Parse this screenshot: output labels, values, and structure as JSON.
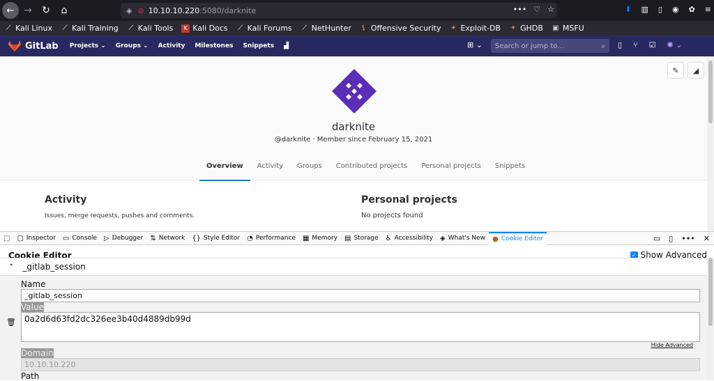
{
  "browser": {
    "url_host": "10.10.10.220",
    "url_rest": ":5080/darknite"
  },
  "bookmarks": [
    {
      "label": "Kali Linux",
      "icon": "kali-dragon-icon"
    },
    {
      "label": "Kali Training",
      "icon": "kali-dragon-icon"
    },
    {
      "label": "Kali Tools",
      "icon": "kali-dragon-icon"
    },
    {
      "label": "Kali Docs",
      "icon": "kali-docs-icon"
    },
    {
      "label": "Kali Forums",
      "icon": "kali-dragon-icon"
    },
    {
      "label": "NetHunter",
      "icon": "kali-dragon-icon"
    },
    {
      "label": "Offensive Security",
      "icon": "offsec-icon"
    },
    {
      "label": "Exploit-DB",
      "icon": "exploitdb-icon"
    },
    {
      "label": "GHDB",
      "icon": "ghdb-icon"
    },
    {
      "label": "MSFU",
      "icon": "msfu-icon"
    }
  ],
  "gitlab": {
    "brand": "GitLab",
    "menu": [
      "Projects ⌄",
      "Groups ⌄",
      "Activity",
      "Milestones",
      "Snippets"
    ],
    "search_placeholder": "Search or jump to…"
  },
  "profile": {
    "name": "darknite",
    "meta": "@darknite  ·  Member since February 15, 2021",
    "tabs": [
      "Overview",
      "Activity",
      "Groups",
      "Contributed projects",
      "Personal projects",
      "Snippets"
    ],
    "activity_heading": "Activity",
    "activity_sub": "Issues, merge requests, pushes and comments.",
    "projects_heading": "Personal projects",
    "projects_sub": "No projects found"
  },
  "devtools": {
    "tabs": [
      {
        "label": "Inspector",
        "icon": "inspector-icon"
      },
      {
        "label": "Console",
        "icon": "console-icon"
      },
      {
        "label": "Debugger",
        "icon": "debugger-icon"
      },
      {
        "label": "Network",
        "icon": "network-icon"
      },
      {
        "label": "Style Editor",
        "icon": "style-editor-icon"
      },
      {
        "label": "Performance",
        "icon": "performance-icon"
      },
      {
        "label": "Memory",
        "icon": "memory-icon"
      },
      {
        "label": "Storage",
        "icon": "storage-icon"
      },
      {
        "label": "Accessibility",
        "icon": "accessibility-icon"
      },
      {
        "label": "What's New",
        "icon": "whats-new-icon"
      },
      {
        "label": "Cookie Editor",
        "icon": "cookie-icon"
      }
    ]
  },
  "cookie_editor": {
    "title": "Cookie Editor",
    "show_advanced": "Show Advanced",
    "cookie_name": "_gitlab_session",
    "name_label": "Name",
    "name_value": "_gitlab_session",
    "value_label": "Value",
    "value_value": "0a2d6d63fd2dc326ee3b40d4889db99d",
    "hide_advanced": "Hide Advanced",
    "domain_label": "Domain",
    "domain_value": "10.10.10.220",
    "path_label": "Path"
  },
  "colors": {
    "gitlab_nav": "#292961",
    "active_tab": "#1f78d1",
    "devtools_active": "#0a84ff"
  }
}
